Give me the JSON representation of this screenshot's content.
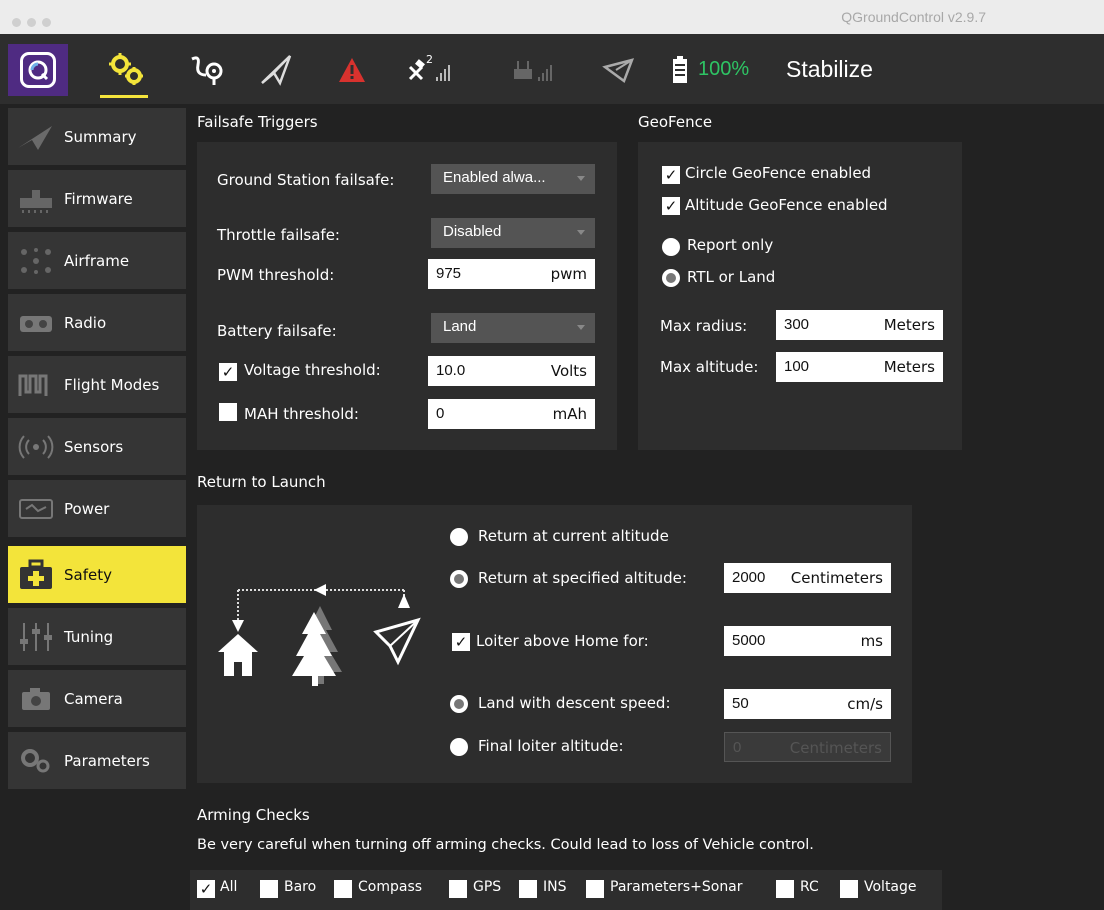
{
  "window": {
    "title": "QGroundControl v2.9.7"
  },
  "toolbar": {
    "battery_pct": "100%",
    "flight_mode": "Stabilize",
    "gps_count": "2",
    "icons": [
      "qgc-logo-icon",
      "gear-icon",
      "plan-icon",
      "paper-plane-icon",
      "warning-icon",
      "gps-icon",
      "rc-signal-icon",
      "telemetry-icon",
      "battery-icon"
    ],
    "colors": {
      "accent": "#f3e43a",
      "logo_bg": "#4f2b82",
      "battery": "#2ec464",
      "warning": "#d8322e"
    }
  },
  "sidebar": {
    "items": [
      {
        "label": "Summary",
        "icon": "paper-plane-icon"
      },
      {
        "label": "Firmware",
        "icon": "firmware-icon"
      },
      {
        "label": "Airframe",
        "icon": "airframe-icon"
      },
      {
        "label": "Radio",
        "icon": "radio-icon"
      },
      {
        "label": "Flight Modes",
        "icon": "flight-modes-icon"
      },
      {
        "label": "Sensors",
        "icon": "sensors-icon"
      },
      {
        "label": "Power",
        "icon": "power-icon"
      },
      {
        "label": "Safety",
        "icon": "safety-icon",
        "active": true
      },
      {
        "label": "Tuning",
        "icon": "tuning-icon"
      },
      {
        "label": "Camera",
        "icon": "camera-icon"
      },
      {
        "label": "Parameters",
        "icon": "parameters-icon"
      }
    ]
  },
  "failsafe": {
    "title": "Failsafe Triggers",
    "gcs_label": "Ground Station failsafe:",
    "gcs_value": "Enabled alwa...",
    "throttle_label": "Throttle failsafe:",
    "throttle_value": "Disabled",
    "pwm_label": "PWM threshold:",
    "pwm_value": "975",
    "pwm_unit": "pwm",
    "battery_label": "Battery failsafe:",
    "battery_value": "Land",
    "voltage_label": "Voltage threshold:",
    "voltage_checked": true,
    "voltage_value": "10.0",
    "voltage_unit": "Volts",
    "mah_label": "MAH threshold:",
    "mah_checked": false,
    "mah_value": "0",
    "mah_unit": "mAh"
  },
  "geofence": {
    "title": "GeoFence",
    "circle_label": "Circle GeoFence enabled",
    "circle_checked": true,
    "altitude_label": "Altitude GeoFence enabled",
    "altitude_checked": true,
    "report_label": "Report only",
    "rtl_label": "RTL or Land",
    "selected_action": "RTL or Land",
    "radius_label": "Max radius:",
    "radius_value": "300",
    "radius_unit": "Meters",
    "maxalt_label": "Max altitude:",
    "maxalt_value": "100",
    "maxalt_unit": "Meters"
  },
  "rtl": {
    "title": "Return to Launch",
    "current_alt_label": "Return at current altitude",
    "specified_alt_label": "Return at specified altitude:",
    "specified_alt_value": "2000",
    "specified_alt_unit": "Centimeters",
    "loiter_label": "Loiter above Home for:",
    "loiter_checked": true,
    "loiter_value": "5000",
    "loiter_unit": "ms",
    "land_label": "Land with descent speed:",
    "land_value": "50",
    "land_unit": "cm/s",
    "final_loiter_label": "Final loiter altitude:",
    "final_loiter_value": "0",
    "final_loiter_unit": "Centimeters"
  },
  "arming": {
    "title": "Arming Checks",
    "warning": "Be very careful when turning off arming checks. Could lead to loss of Vehicle control.",
    "checks": [
      {
        "label": "All",
        "checked": true
      },
      {
        "label": "Baro",
        "checked": false
      },
      {
        "label": "Compass",
        "checked": false
      },
      {
        "label": "GPS",
        "checked": false
      },
      {
        "label": "INS",
        "checked": false
      },
      {
        "label": "Parameters+Sonar",
        "checked": false
      },
      {
        "label": "RC",
        "checked": false
      },
      {
        "label": "Voltage",
        "checked": false
      }
    ]
  }
}
